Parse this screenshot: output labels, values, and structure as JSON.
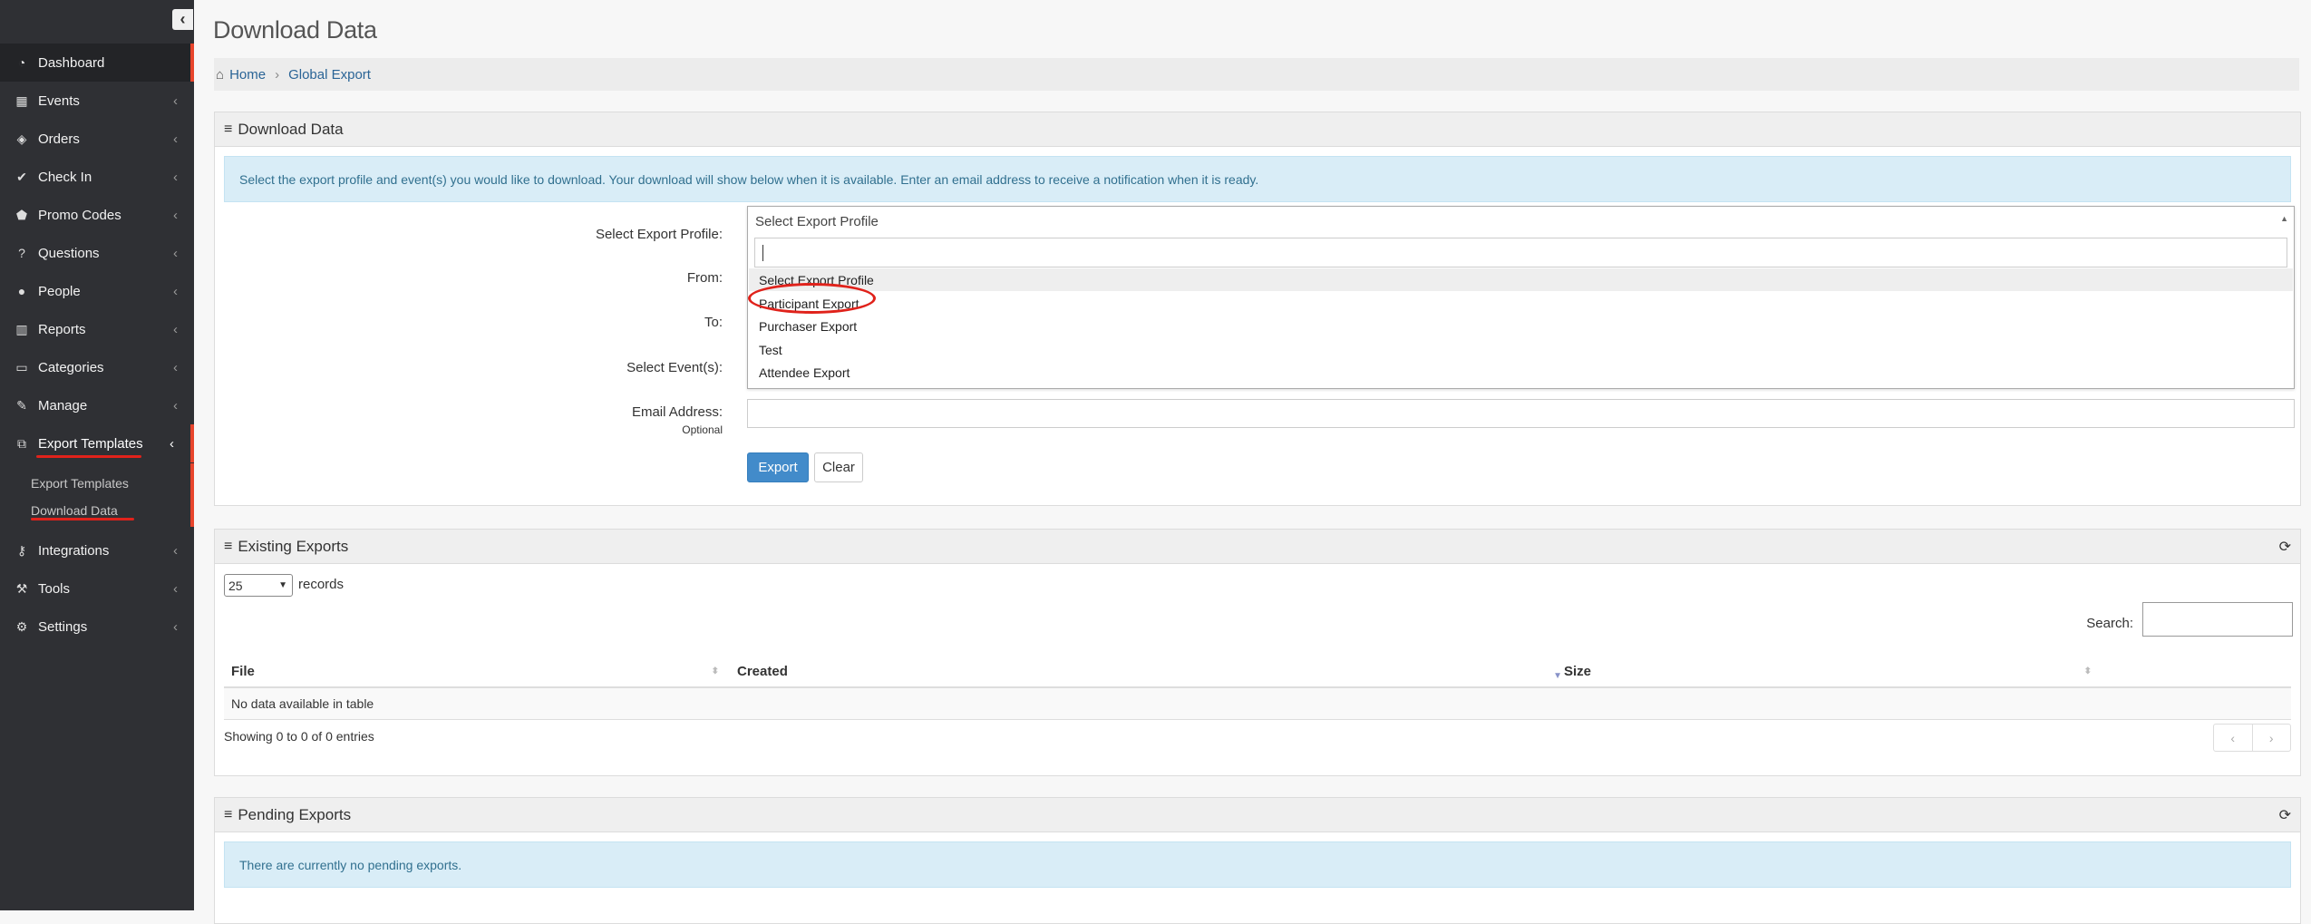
{
  "sidebar": {
    "items": [
      {
        "label": "Dashboard",
        "icon": "dashboard-icon"
      },
      {
        "label": "Events",
        "icon": "calendar-icon"
      },
      {
        "label": "Orders",
        "icon": "tickets-icon"
      },
      {
        "label": "Check In",
        "icon": "check-icon"
      },
      {
        "label": "Promo Codes",
        "icon": "tag-icon"
      },
      {
        "label": "Questions",
        "icon": "question-icon"
      },
      {
        "label": "People",
        "icon": "user-icon"
      },
      {
        "label": "Reports",
        "icon": "bar-chart-icon"
      },
      {
        "label": "Categories",
        "icon": "folder-icon"
      },
      {
        "label": "Manage",
        "icon": "edit-icon"
      },
      {
        "label": "Export Templates",
        "icon": "external-link-icon"
      },
      {
        "label": "Integrations",
        "icon": "key-icon"
      },
      {
        "label": "Tools",
        "icon": "wrench-icon"
      },
      {
        "label": "Settings",
        "icon": "cogs-icon"
      }
    ],
    "sub_items": [
      {
        "label": "Export Templates"
      },
      {
        "label": "Download Data"
      }
    ]
  },
  "page": {
    "title": "Download Data"
  },
  "breadcrumb": {
    "home": "Home",
    "current": "Global Export"
  },
  "download_panel": {
    "title": "Download Data",
    "info": "Select the export profile and event(s) you would like to download. Your download will show below when it is available. Enter an email address to receive a notification when it is ready.",
    "labels": {
      "profile": "Select Export Profile:",
      "from": "From:",
      "to": "To:",
      "events": "Select Event(s):",
      "email": "Email Address:",
      "optional": "Optional"
    },
    "dropdown": {
      "selected": "Select Export Profile",
      "search_value": "",
      "options": [
        "Select Export Profile",
        "Participant Export",
        "Purchaser Export",
        "Test",
        "Attendee Export"
      ]
    },
    "buttons": {
      "export": "Export",
      "clear": "Clear"
    }
  },
  "existing_panel": {
    "title": "Existing Exports",
    "page_length": "25",
    "records_label": "records",
    "search_label": "Search:",
    "columns": [
      "File",
      "Created",
      "Size"
    ],
    "empty": "No data available in table",
    "info": "Showing 0 to 0 of 0 entries",
    "prev": "‹",
    "next": "›"
  },
  "pending_panel": {
    "title": "Pending Exports",
    "info": "There are currently no pending exports."
  },
  "colors": {
    "sidebar_bg": "#2f3034",
    "accent_red": "#e8452c",
    "link": "#2a6496",
    "primary_button": "#428bca",
    "info_bg": "#d9edf7"
  }
}
